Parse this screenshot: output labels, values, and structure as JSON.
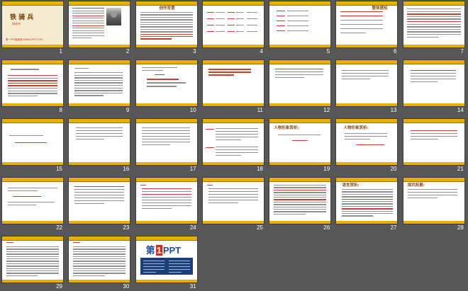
{
  "slides": [
    {
      "number": "1",
      "title": "铁 骑 兵",
      "author": "邢庆杰",
      "footer": "第一PPT模板网-WWW.1PPT.COM"
    },
    {
      "number": "2"
    },
    {
      "number": "3",
      "heading": "创作背景"
    },
    {
      "number": "4"
    },
    {
      "number": "5"
    },
    {
      "number": "6",
      "heading": "整体感知"
    },
    {
      "number": "7"
    },
    {
      "number": "8"
    },
    {
      "number": "9"
    },
    {
      "number": "10"
    },
    {
      "number": "11"
    },
    {
      "number": "12"
    },
    {
      "number": "13"
    },
    {
      "number": "14"
    },
    {
      "number": "15"
    },
    {
      "number": "16"
    },
    {
      "number": "17"
    },
    {
      "number": "18"
    },
    {
      "number": "19",
      "heading": "人物形象赏析:"
    },
    {
      "number": "20",
      "heading": "人物形象赏析:"
    },
    {
      "number": "21"
    },
    {
      "number": "22"
    },
    {
      "number": "23"
    },
    {
      "number": "24"
    },
    {
      "number": "25"
    },
    {
      "number": "26"
    },
    {
      "number": "27",
      "heading": "语言赏析:"
    },
    {
      "number": "28",
      "heading": "探究拓展:"
    },
    {
      "number": "29"
    },
    {
      "number": "30"
    },
    {
      "number": "31",
      "logo": {
        "part1": "第",
        "part2": "1",
        "part3": "PPT"
      }
    }
  ],
  "colors": {
    "background": "#575757",
    "band": "#e8ae00",
    "cover": "#f5ebd1",
    "heading": "#8b4a13",
    "accent_red": "#d13b2b",
    "logo_blue": "#1f4e9c"
  }
}
